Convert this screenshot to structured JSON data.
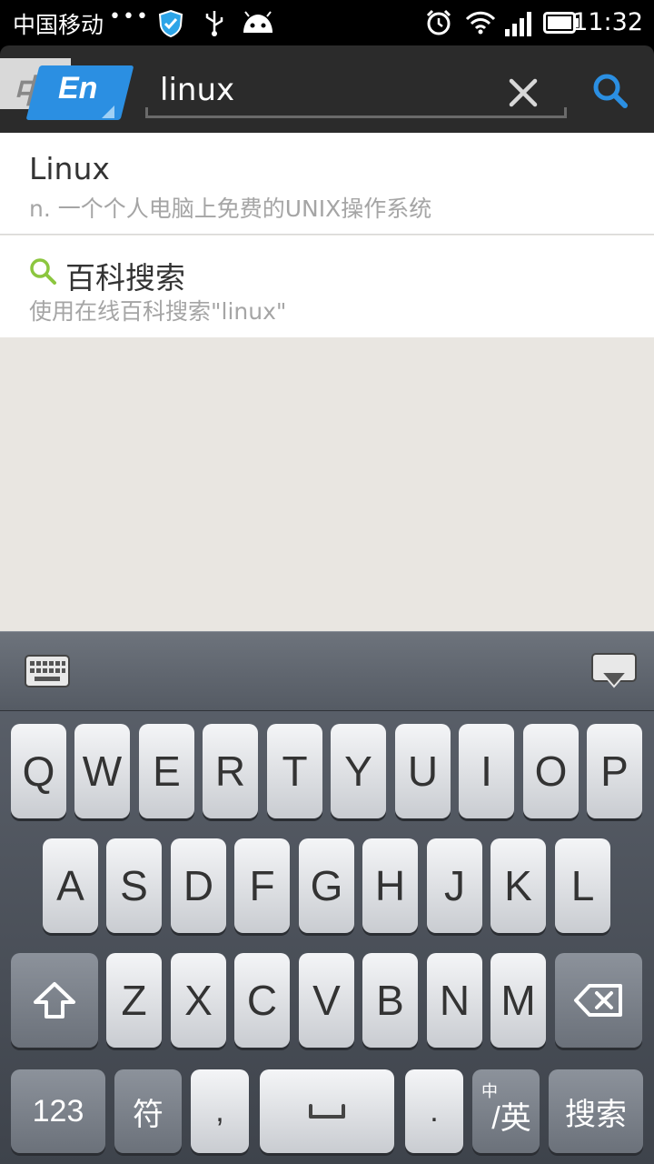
{
  "status_bar": {
    "carrier": "中国移动",
    "dots": "•••",
    "time": "11:32",
    "icons": [
      "shield-check-icon",
      "usb-icon",
      "android-icon",
      "alarm-icon",
      "wifi-icon",
      "signal-icon",
      "battery-icon"
    ]
  },
  "header": {
    "lang_back": "中",
    "lang_front": "En",
    "search_value": "linux",
    "accent_color": "#2b8fe2"
  },
  "results": [
    {
      "title": "Linux",
      "subtitle": "n. 一个个人电脑上免费的UNIX操作系统"
    },
    {
      "title": "百科搜索",
      "subtitle": "使用在线百科搜索\"linux\"",
      "icon": "search-icon",
      "icon_color": "#8cc63f"
    }
  ],
  "keyboard": {
    "row1": [
      "Q",
      "W",
      "E",
      "R",
      "T",
      "Y",
      "U",
      "I",
      "O",
      "P"
    ],
    "row2": [
      "A",
      "S",
      "D",
      "F",
      "G",
      "H",
      "J",
      "K",
      "L"
    ],
    "row3": [
      "Z",
      "X",
      "C",
      "V",
      "B",
      "N",
      "M"
    ],
    "row4": {
      "num": "123",
      "symbol": "符",
      "comma": ",",
      "period": ".",
      "lang_sup": "中",
      "lang_main": "/英",
      "search": "搜索"
    }
  }
}
